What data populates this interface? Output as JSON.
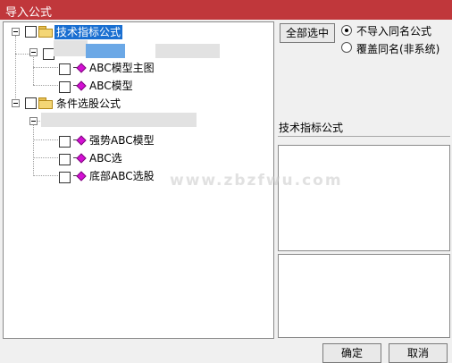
{
  "window": {
    "title": "导入公式"
  },
  "tree": {
    "nodes": [
      {
        "label": "技术指标公式",
        "selected": true
      },
      {
        "label": "ABC模型主图"
      },
      {
        "label": "ABC模型"
      },
      {
        "label": "条件选股公式"
      },
      {
        "label": "强势ABC模型"
      },
      {
        "label": "ABC选"
      },
      {
        "label": "底部ABC选股"
      }
    ]
  },
  "controls": {
    "select_all": "全部选中",
    "option_no_import": "不导入同名公式",
    "option_overwrite": "覆盖同名(非系统)",
    "selected_option": "不导入同名公式"
  },
  "info": {
    "category_label": "技术指标公式"
  },
  "footer": {
    "ok_label": "确定",
    "cancel_label": "取消"
  },
  "watermark": "www.zbzfwu.com",
  "colors": {
    "titlebar": "#c0373b",
    "selection": "#1a6fd1",
    "formula_icon": "#d40fd4"
  }
}
